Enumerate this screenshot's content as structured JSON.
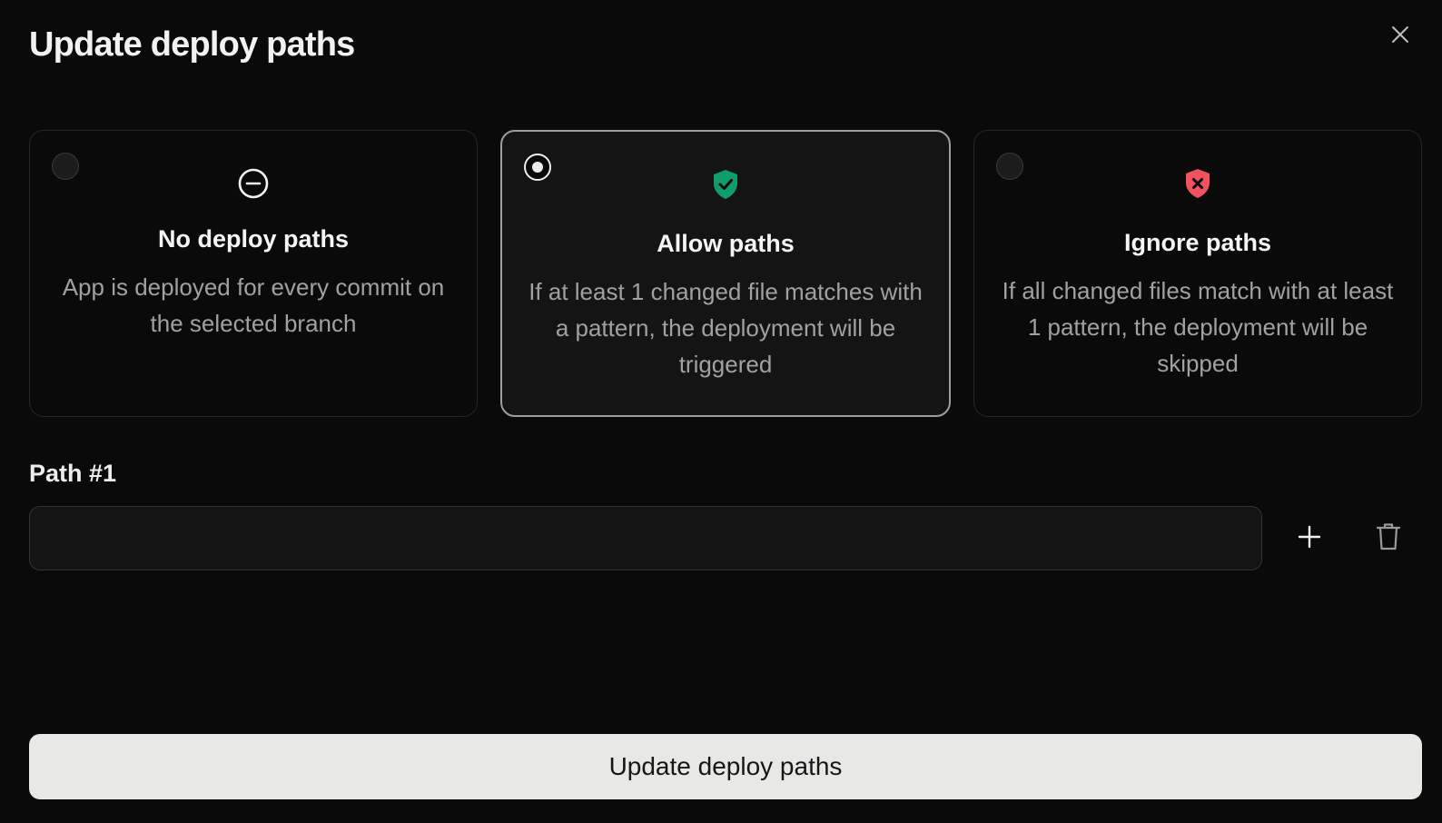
{
  "dialog": {
    "title": "Update deploy paths",
    "close_icon": "close-icon"
  },
  "options": [
    {
      "title": "No deploy paths",
      "description": "App is deployed for every commit on the selected branch",
      "icon": "minus-circle-icon",
      "selected": false
    },
    {
      "title": "Allow paths",
      "description": "If at least 1 changed file matches with a pattern, the deployment will be triggered",
      "icon": "shield-check-icon",
      "icon_color": "#0f9d6a",
      "selected": true
    },
    {
      "title": "Ignore paths",
      "description": "If all changed files match with at least 1 pattern, the deployment will be skipped",
      "icon": "shield-x-icon",
      "icon_color": "#f0525f",
      "selected": false
    }
  ],
  "path": {
    "label": "Path #1",
    "value": "",
    "add_icon": "plus-icon",
    "delete_icon": "trash-icon"
  },
  "submit": {
    "label": "Update deploy paths"
  },
  "colors": {
    "background": "#0a0a0a",
    "selected_border": "#9e9e9e",
    "button_bg": "#e8e8e6"
  }
}
